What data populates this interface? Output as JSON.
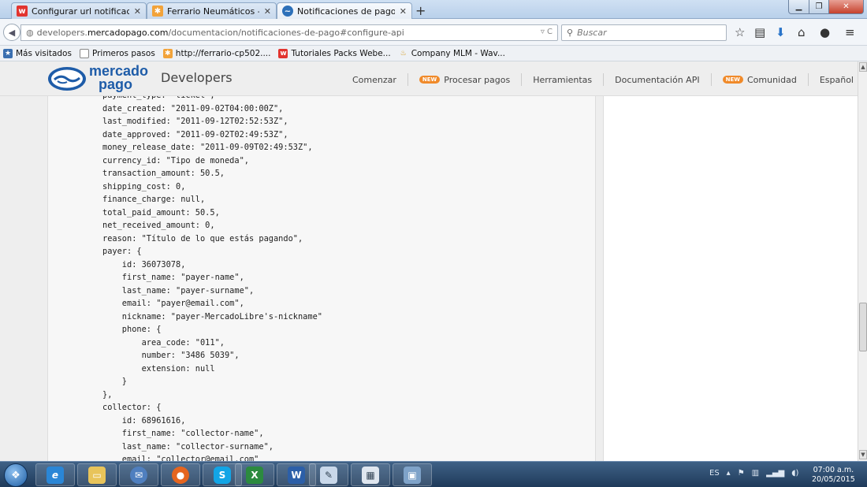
{
  "browser": {
    "tabs": [
      {
        "label": "Configurar url notificación ...",
        "icon": "w-favicon-icon",
        "active": false
      },
      {
        "label": "Ferrario Neumáticos - Ad...",
        "icon": "joomla-favicon-icon",
        "active": false
      },
      {
        "label": "Notificaciones de pagos (I...",
        "icon": "mercadopago-favicon-icon",
        "active": true
      }
    ],
    "url_prefix": "developers.",
    "url_domain": "mercadopago.com",
    "url_path": "/documentacion/notificaciones-de-pago#configure-api",
    "search_placeholder": "Buscar",
    "bookmarks": [
      {
        "label": "Más visitados",
        "icon": "bookmark-star-icon"
      },
      {
        "label": "Primeros pasos",
        "icon": "page-icon"
      },
      {
        "label": "http://ferrario-cp502....",
        "icon": "joomla-favicon-icon"
      },
      {
        "label": "Tutoriales Packs Webe...",
        "icon": "w-favicon-icon"
      },
      {
        "label": "Company MLM - Wav...",
        "icon": "wave-favicon-icon"
      }
    ]
  },
  "site": {
    "logo_line1": "mercado",
    "logo_line2": "pago",
    "section_title": "Developers",
    "nav": [
      {
        "label": "Comenzar",
        "badge": ""
      },
      {
        "label": "Procesar pagos",
        "badge": "NEW"
      },
      {
        "label": "Herramientas",
        "badge": ""
      },
      {
        "label": "Documentación API",
        "badge": ""
      },
      {
        "label": "Comunidad",
        "badge": "NEW"
      },
      {
        "label": "Español",
        "badge": ""
      }
    ]
  },
  "code_lines": [
    "payment_type: \"ticket\",",
    "date_created: \"2011-09-02T04:00:00Z\",",
    "last_modified: \"2011-09-12T02:52:53Z\",",
    "date_approved: \"2011-09-02T02:49:53Z\",",
    "money_release_date: \"2011-09-09T02:49:53Z\",",
    "currency_id: \"Tipo de moneda\",",
    "transaction_amount: 50.5,",
    "shipping_cost: 0,",
    "finance_charge: null,",
    "total_paid_amount: 50.5,",
    "net_received_amount: 0,",
    "reason: \"Título de lo que estás pagando\",",
    "payer: {",
    "    id: 36073078,",
    "    first_name: \"payer-name\",",
    "    last_name: \"payer-surname\",",
    "    email: \"payer@email.com\",",
    "    nickname: \"payer-MercadoLibre's-nickname\"",
    "    phone: {",
    "        area_code: \"011\",",
    "        number: \"3486 5039\",",
    "        extension: null",
    "    }",
    "},",
    "collector: {",
    "    id: 68961616,",
    "    first_name: \"collector-name\",",
    "    last_name: \"collector-surname\",",
    "    email: \"collector@email.com\""
  ],
  "taskbar": {
    "apps": [
      "internet-explorer-icon",
      "file-explorer-icon",
      "thunderbird-icon",
      "firefox-icon",
      "skype-icon",
      "excel-icon",
      "word-icon",
      "paint-icon",
      "presentation-icon",
      "image-viewer-icon"
    ],
    "language": "ES",
    "time": "07:00 a.m.",
    "date": "20/05/2015"
  }
}
